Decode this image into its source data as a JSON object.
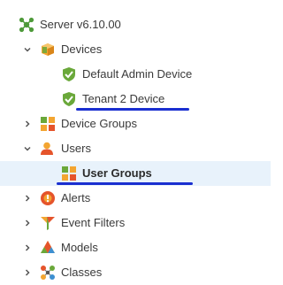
{
  "tree": {
    "root": {
      "label": "Server v6.10.00",
      "icon": "server-cluster-icon"
    },
    "devices": {
      "label": "Devices",
      "icon": "devices-cube-icon",
      "expanded": true,
      "children": [
        {
          "label": "Default Admin Device",
          "icon": "shield-check-icon"
        },
        {
          "label": "Tenant 2 Device",
          "icon": "shield-check-icon",
          "underlined": true
        }
      ]
    },
    "device_groups": {
      "label": "Device Groups",
      "icon": "device-groups-icon",
      "expanded": false
    },
    "users": {
      "label": "Users",
      "icon": "user-icon",
      "expanded": true,
      "children": [
        {
          "label": "User Groups",
          "icon": "user-groups-icon",
          "selected": true,
          "underlined": true
        }
      ]
    },
    "alerts": {
      "label": "Alerts",
      "icon": "alert-icon",
      "expanded": false
    },
    "event_filters": {
      "label": "Event Filters",
      "icon": "filter-icon",
      "expanded": false
    },
    "models": {
      "label": "Models",
      "icon": "models-icon",
      "expanded": false
    },
    "classes": {
      "label": "Classes",
      "icon": "classes-icon",
      "expanded": false
    }
  },
  "colors": {
    "selection_bg": "#e8f2fb",
    "underline": "#1a2fd0",
    "shield_green": "#6aa83a",
    "server_green": "#4e9a3a"
  }
}
